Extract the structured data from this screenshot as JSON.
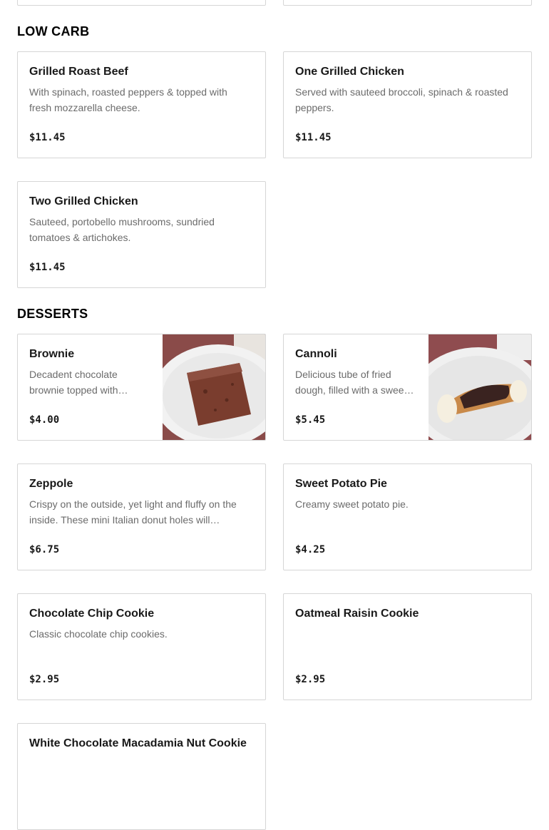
{
  "sections": {
    "low_carb": {
      "title": "LOW CARB",
      "items": [
        {
          "name": "Grilled Roast Beef",
          "description": "With spinach, roasted peppers & topped with fresh mozzarella cheese.",
          "price": "$11.45"
        },
        {
          "name": "One Grilled Chicken",
          "description": "Served with sauteed broccoli, spinach & roasted peppers.",
          "price": "$11.45"
        },
        {
          "name": "Two Grilled Chicken",
          "description": "Sauteed, portobello mushrooms, sundried tomatoes & artichokes.",
          "price": "$11.45"
        }
      ]
    },
    "desserts": {
      "title": "DESSERTS",
      "items": [
        {
          "name": "Brownie",
          "description": "Decadent chocolate brownie topped with…",
          "price": "$4.00",
          "image": "brownie-photo"
        },
        {
          "name": "Cannoli",
          "description": "Delicious tube of fried dough, filled with a swee…",
          "price": "$5.45",
          "image": "cannoli-photo"
        },
        {
          "name": "Zeppole",
          "description": "Crispy on the outside, yet light and fluffy on the inside. These mini Italian donut holes will…",
          "price": "$6.75"
        },
        {
          "name": "Sweet Potato Pie",
          "description": "Creamy sweet potato pie.",
          "price": "$4.25"
        },
        {
          "name": "Chocolate Chip Cookie",
          "description": "Classic chocolate chip cookies.",
          "price": "$2.95"
        },
        {
          "name": "Oatmeal Raisin Cookie",
          "description": "",
          "price": "$2.95"
        },
        {
          "name": "White Chocolate Macadamia Nut Cookie",
          "description": "",
          "price": ""
        }
      ]
    }
  }
}
